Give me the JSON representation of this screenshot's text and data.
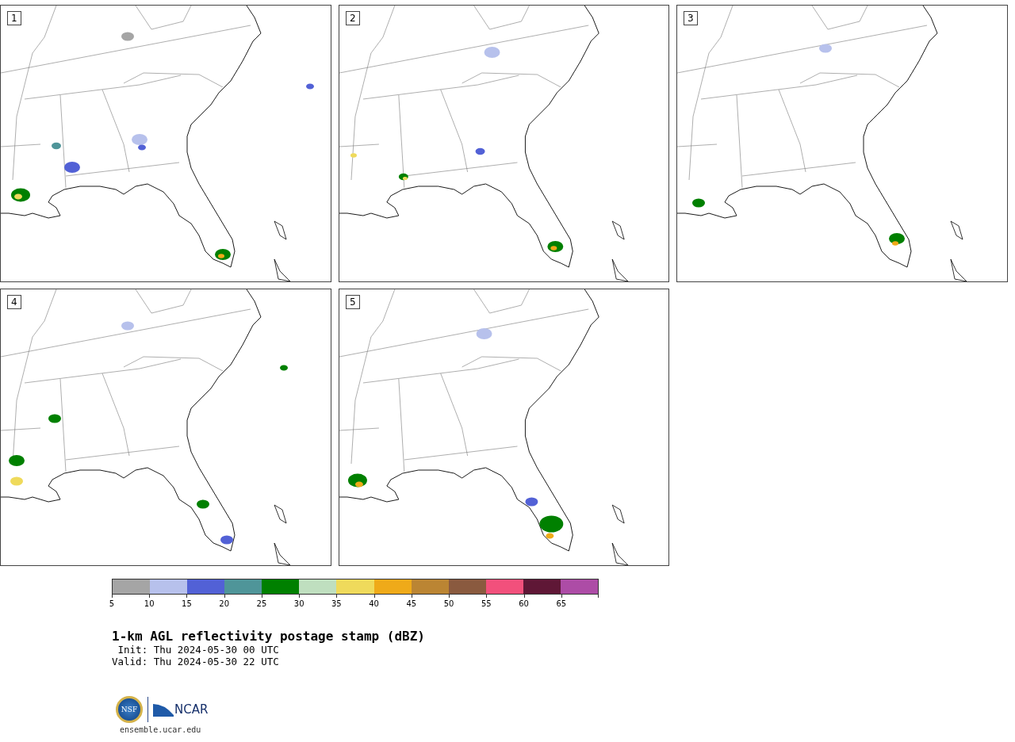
{
  "panels": [
    {
      "number": "1"
    },
    {
      "number": "2"
    },
    {
      "number": "3"
    },
    {
      "number": "4"
    },
    {
      "number": "5"
    }
  ],
  "colorbar": {
    "bins": [
      {
        "label": "5",
        "color": "#a5a5a5"
      },
      {
        "label": "10",
        "color": "#b7c1ec"
      },
      {
        "label": "15",
        "color": "#5261d6"
      },
      {
        "label": "20",
        "color": "#4f9599"
      },
      {
        "label": "25",
        "color": "#008000"
      },
      {
        "label": "30",
        "color": "#bfdfbf"
      },
      {
        "label": "35",
        "color": "#efda5b"
      },
      {
        "label": "40",
        "color": "#efaa19"
      },
      {
        "label": "45",
        "color": "#bb8533"
      },
      {
        "label": "50",
        "color": "#8a5a3f"
      },
      {
        "label": "55",
        "color": "#f2507c"
      },
      {
        "label": "60",
        "color": "#5f1736"
      },
      {
        "label": "65",
        "color": "#ad4ca6"
      }
    ]
  },
  "title": "1-km AGL reflectivity postage stamp (dBZ)",
  "init": " Init: Thu 2024-05-30 00 UTC",
  "valid": "Valid: Thu 2024-05-30 22 UTC",
  "logos": {
    "seal_text": "NSF",
    "wordmark": "NCAR",
    "url": "ensemble.ucar.edu"
  }
}
